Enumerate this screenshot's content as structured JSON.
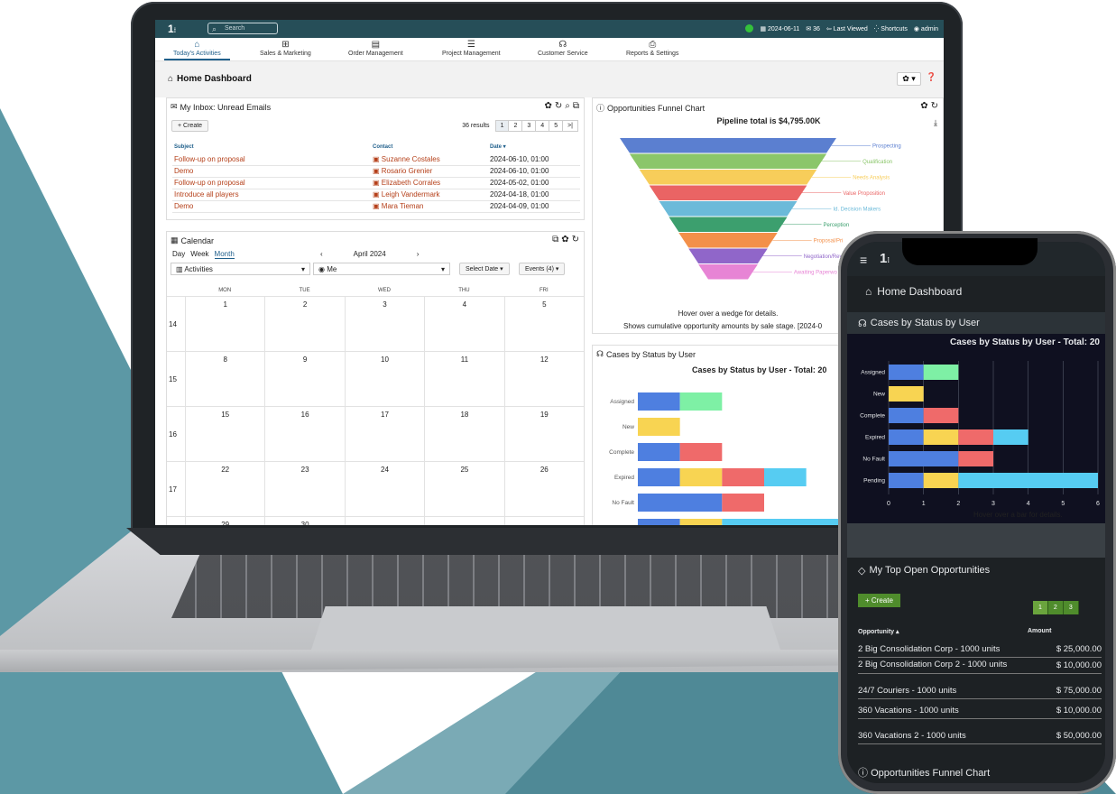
{
  "topbar": {
    "search_placeholder": "Search",
    "date": "2024-06-11",
    "inbox_count": "36",
    "last_viewed": "Last Viewed",
    "shortcuts": "Shortcuts",
    "user": "admin"
  },
  "nav": [
    "Today's Activities",
    "Sales & Marketing",
    "Order Management",
    "Project Management",
    "Customer Service",
    "Reports & Settings"
  ],
  "page": {
    "title": "Home Dashboard"
  },
  "inbox": {
    "title": "My Inbox: Unread Emails",
    "create_label": "Create",
    "results": "36 results",
    "pages": [
      "1",
      "2",
      "3",
      "4",
      "5",
      ">|"
    ],
    "columns": [
      "Subject",
      "Contact",
      "Date"
    ],
    "rows": [
      {
        "subject": "Follow-up on proposal",
        "contact": "Suzanne Costales",
        "date": "2024-06-10, 01:00"
      },
      {
        "subject": "Demo",
        "contact": "Rosario Grenier",
        "date": "2024-06-10, 01:00"
      },
      {
        "subject": "Follow-up on proposal",
        "contact": "Elizabeth Corrales",
        "date": "2024-05-02, 01:00"
      },
      {
        "subject": "Introduce all players",
        "contact": "Leigh Vandermark",
        "date": "2024-04-18, 01:00"
      },
      {
        "subject": "Demo",
        "contact": "Mara Tieman",
        "date": "2024-04-09, 01:00"
      }
    ]
  },
  "calendar": {
    "title": "Calendar",
    "views": [
      "Day",
      "Week",
      "Month"
    ],
    "month": "April 2024",
    "activity_filter": "Activities",
    "user_filter": "Me",
    "select_date": "Select Date",
    "events": "Events (4)",
    "days": [
      "MON",
      "TUE",
      "WED",
      "THU",
      "FRI"
    ],
    "weeks": [
      {
        "num": "14",
        "d": [
          "1",
          "2",
          "3",
          "4",
          "5"
        ]
      },
      {
        "num": "15",
        "d": [
          "8",
          "9",
          "10",
          "11",
          "12"
        ]
      },
      {
        "num": "16",
        "d": [
          "15",
          "16",
          "17",
          "18",
          "19"
        ]
      },
      {
        "num": "17",
        "d": [
          "22",
          "23",
          "24",
          "25",
          "26"
        ]
      },
      {
        "num": "",
        "d": [
          "29",
          "30"
        ]
      }
    ]
  },
  "funnel": {
    "title": "Opportunities Funnel Chart",
    "hint": "Hover over a wedge for details.",
    "caption": "Shows cumulative opportunity amounts by sale stage. [2024-0"
  },
  "cases": {
    "title": "Cases by Status by User",
    "hint": "Hover over a bar for details."
  },
  "opps": {
    "title": "My Top Open Opportunities",
    "create_label": "Create",
    "pages": [
      "1",
      "2",
      "3"
    ],
    "columns": [
      "Opportunity",
      "Amount"
    ],
    "rows": [
      {
        "name": "2 Big Consolidation Corp - 1000 units",
        "amount": "$ 25,000.00"
      },
      {
        "name": "2 Big Consolidation Corp 2 - 1000 units",
        "amount": "$ 10,000.00"
      },
      {
        "name": "24/7 Couriers - 1000 units",
        "amount": "$ 75,000.00"
      },
      {
        "name": "360 Vacations - 1000 units",
        "amount": "$ 10,000.00"
      },
      {
        "name": "360 Vacations 2 - 1000 units",
        "amount": "$ 50,000.00"
      }
    ]
  },
  "chart_data": [
    {
      "type": "funnel",
      "title": "Pipeline total is $4,795.00K",
      "categories": [
        "Prospecting",
        "Qualification",
        "Needs Analysis",
        "Value Proposition",
        "Id. Decision Makers",
        "Perception Analysis",
        "Proposal/Price Quote",
        "Negotiation/Review",
        "Awaiting Paperwork"
      ],
      "visible_labels": [
        "Prospecting",
        "Qualification",
        "Needs Analysis",
        "Value Proposition",
        "Id. Decision Makers",
        "Perception",
        "Proposal/Pri",
        "Negotiation/Rev",
        "Awaiting Paperwo"
      ],
      "colors": [
        "#5b7fd0",
        "#8bc66a",
        "#f7cd5a",
        "#ea6464",
        "#6bbad9",
        "#3c9f6e",
        "#f3904a",
        "#9066c9",
        "#e784d5"
      ]
    },
    {
      "type": "bar",
      "orientation": "horizontal-stacked",
      "title": "Cases by Status by User - Total: 20",
      "categories": [
        "Assigned",
        "New",
        "Complete",
        "Expired",
        "No Fault",
        "Pending"
      ],
      "series": [
        {
          "values": [
            1,
            0,
            1,
            1,
            2,
            1
          ],
          "color": "#4e7fe0"
        },
        {
          "values": [
            1,
            0,
            0,
            0,
            0,
            0
          ],
          "color": "#7ef0a5"
        },
        {
          "values": [
            0,
            1,
            0,
            1,
            0,
            1
          ],
          "color": "#f8d452"
        },
        {
          "values": [
            0,
            0,
            1,
            1,
            1,
            0
          ],
          "color": "#ef6a6a"
        },
        {
          "values": [
            0,
            0,
            0,
            1,
            0,
            4
          ],
          "color": "#56ccf2"
        }
      ],
      "xlim": [
        0,
        6
      ],
      "xticks": [
        0,
        1,
        2,
        3,
        4,
        5,
        6
      ]
    }
  ]
}
